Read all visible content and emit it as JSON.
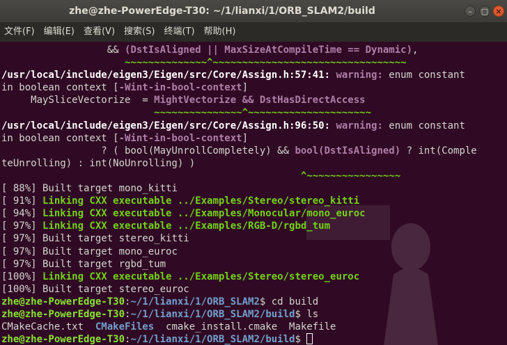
{
  "window": {
    "title": "zhe@zhe-PowerEdge-T30: ~/1/lianxi/1/ORB_SLAM2/build",
    "buttons": {
      "minimize": "–",
      "maximize": "□",
      "close": "×"
    }
  },
  "menubar": [
    "文件(F)",
    "编辑(E)",
    "查看(V)",
    "搜索(S)",
    "终端(T)",
    "帮助(H)"
  ],
  "terminal": {
    "l1": [
      "                  && ",
      "(DstIsAligned || MaxSizeAtCompileTime == Dynamic)",
      ","
    ],
    "l2": "                     ~~~~~~~~~~~~~~^~~~~~~~~~~~~~~~~~~~~~~~~~~~~~~~~~",
    "l3": [
      "/usr/local/include/eigen3/Eigen/src/Core/Assign.h:57:41:",
      " warning:",
      " enum constant"
    ],
    "l4": [
      "in boolean context [",
      "-Wint-in-bool-context",
      "]"
    ],
    "l5": [
      "     MaySliceVectorize  = ",
      "MightVectorize && DstHasDirectAccess"
    ],
    "l6": "                          ~~~~~~~~~~~~~~~^~~~~~~~~~~~~~~~~~~~~~",
    "l7": [
      "/usr/local/include/eigen3/Eigen/src/Core/Assign.h:96:50:",
      " warning:",
      " enum constant"
    ],
    "l8": [
      "in boolean context [",
      "-Wint-in-bool-context",
      "]"
    ],
    "l9": [
      "                 ? ( bool(MayUnrollCompletely) && ",
      "bool(DstIsAligned)",
      " ? int(Comple"
    ],
    "l10": "teUnrolling) : int(NoUnrolling) )",
    "l11": "                                                   ^~~~~~~~~~~~~~~~~",
    "build": [
      {
        "pct": "[ 88%]",
        "text": " Built target mono_kitti",
        "link": false
      },
      {
        "pct": "[ 91%]",
        "text": " Linking CXX executable ../Examples/Stereo/stereo_kitti",
        "link": true
      },
      {
        "pct": "[ 94%]",
        "text": " Linking CXX executable ../Examples/Monocular/mono_euroc",
        "link": true
      },
      {
        "pct": "[ 97%]",
        "text": " Linking CXX executable ../Examples/RGB-D/rgbd_tum",
        "link": true
      },
      {
        "pct": "[ 97%]",
        "text": " Built target stereo_kitti",
        "link": false
      },
      {
        "pct": "[ 97%]",
        "text": " Built target mono_euroc",
        "link": false
      },
      {
        "pct": "[ 97%]",
        "text": " Built target rgbd_tum",
        "link": false
      },
      {
        "pct": "[100%]",
        "text": " Linking CXX executable ../Examples/Stereo/stereo_euroc",
        "link": true
      },
      {
        "pct": "[100%]",
        "text": " Built target stereo_euroc",
        "link": false
      }
    ],
    "prompt_user": "zhe@zhe-PowerEdge-T30",
    "prompt_colon": ":",
    "path1": "~/1/lianxi/1/ORB_SLAM2",
    "cmd1": "$ cd build",
    "path2": "~/1/lianxi/1/ORB_SLAM2/build",
    "cmd2": "$ ls",
    "ls": [
      "CMakeCache.txt  ",
      "CMakeFiles",
      "  cmake_install.cmake  Makefile"
    ],
    "path3": "~/1/lianxi/1/ORB_SLAM2/build",
    "cmd3": "$ "
  },
  "colors": {
    "background": "#300a24",
    "prompt": "#8ae234",
    "path": "#729fcf",
    "warning": "#ad7fa8",
    "link": "#73d216"
  }
}
